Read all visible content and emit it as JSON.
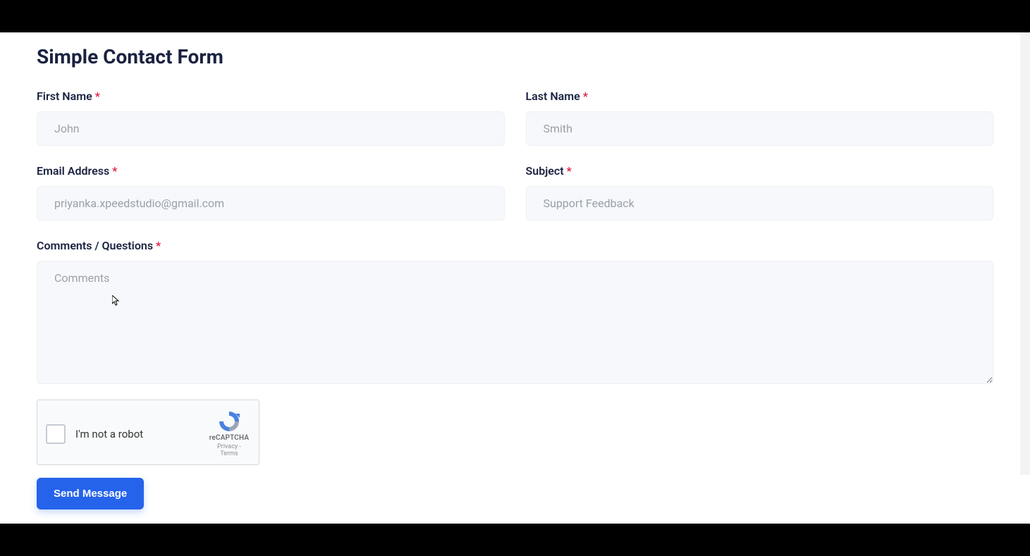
{
  "title": "Simple Contact Form",
  "fields": {
    "first_name": {
      "label": "First Name",
      "placeholder": "John",
      "required": "*"
    },
    "last_name": {
      "label": "Last Name",
      "placeholder": "Smith",
      "required": "*"
    },
    "email": {
      "label": "Email Address",
      "placeholder": "priyanka.xpeedstudio@gmail.com",
      "required": "*"
    },
    "subject": {
      "label": "Subject",
      "placeholder": "Support Feedback",
      "required": "*"
    },
    "comments": {
      "label": "Comments / Questions",
      "placeholder": "Comments",
      "required": "*"
    }
  },
  "recaptcha": {
    "label": "I'm not a robot",
    "brand": "reCAPTCHA",
    "links": "Privacy - Terms"
  },
  "submit": {
    "label": "Send Message"
  }
}
